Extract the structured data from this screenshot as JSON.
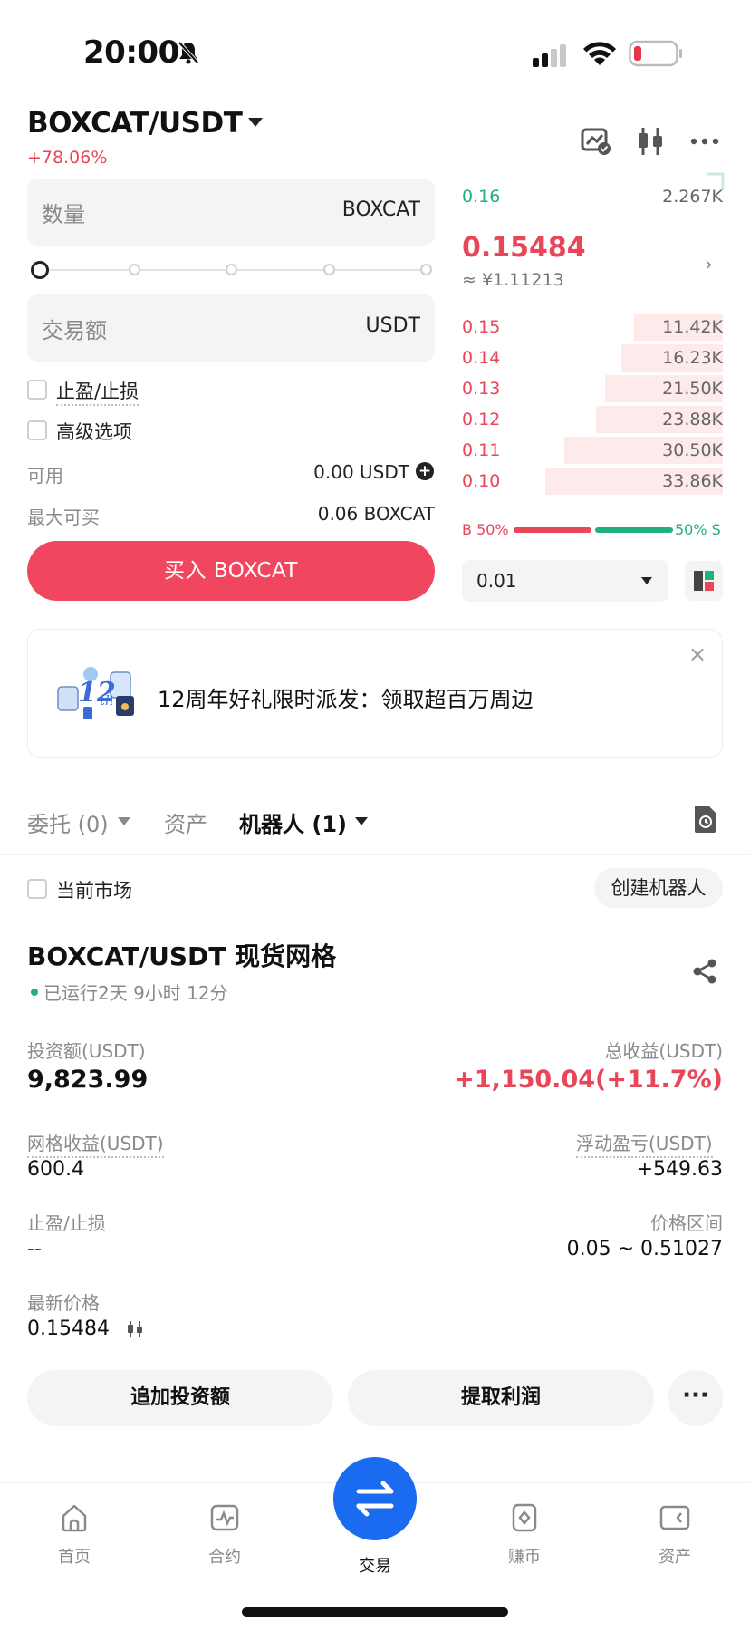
{
  "status_bar": {
    "time": "20:00"
  },
  "header": {
    "pair": "BOXCAT/USDT",
    "change": "+78.06%"
  },
  "order_form": {
    "quantity_placeholder": "数量",
    "quantity_unit": "BOXCAT",
    "amount_placeholder": "交易额",
    "amount_unit": "USDT",
    "tp_sl_label": "止盈/止损",
    "advanced_label": "高级选项",
    "available_label": "可用",
    "available_value": "0.00 USDT",
    "max_buy_label": "最大可买",
    "max_buy_value": "0.06 BOXCAT",
    "buy_button": "买入 BOXCAT",
    "slider_value_percent": 0
  },
  "orderbook": {
    "ask_top": {
      "price": "0.16",
      "qty": "2.267K"
    },
    "last_price": "0.15484",
    "cny_price": "≈ ¥1.11213",
    "bids": [
      {
        "price": "0.15",
        "qty": "11.42K",
        "depth": 0.28
      },
      {
        "price": "0.14",
        "qty": "16.23K",
        "depth": 0.32
      },
      {
        "price": "0.13",
        "qty": "21.50K",
        "depth": 0.37
      },
      {
        "price": "0.12",
        "qty": "23.88K",
        "depth": 0.4
      },
      {
        "price": "0.11",
        "qty": "30.50K",
        "depth": 0.5
      },
      {
        "price": "0.10",
        "qty": "33.86K",
        "depth": 0.56
      }
    ],
    "buy_ratio_label": "B 50%",
    "sell_ratio_label": "50% S",
    "buy_ratio": 0.5,
    "precision": "0.01"
  },
  "banner": {
    "text": "12周年好礼限时派发：领取超百万周边",
    "close": "×"
  },
  "tabs": {
    "orders": "委托 (0)",
    "assets": "资产",
    "bots": "机器人 (1)"
  },
  "filter": {
    "current_market": "当前市场",
    "create_bot": "创建机器人"
  },
  "bot": {
    "title": "BOXCAT/USDT 现货网格",
    "running": "已运行2天 9小时 12分",
    "investment_label": "投资额(USDT)",
    "investment_value": "9,823.99",
    "total_profit_label": "总收益(USDT)",
    "total_profit_value": "+1,150.04(+11.7%)",
    "grid_profit_label": "网格收益(USDT)",
    "grid_profit_value": "600.4",
    "floating_pnl_label": "浮动盈亏(USDT)",
    "floating_pnl_value": "+549.63",
    "tp_sl_label": "止盈/止损",
    "tp_sl_value": "--",
    "price_range_label": "价格区间",
    "price_range_value": "0.05 ~ 0.51027",
    "latest_price_label": "最新价格",
    "latest_price_value": "0.15484",
    "add_investment": "追加投资额",
    "withdraw_profit": "提取利润",
    "more": "···"
  },
  "bottom_nav": {
    "home": "首页",
    "futures": "合约",
    "trade": "交易",
    "earn": "赚币",
    "assets": "资产"
  },
  "colors": {
    "red": "#e8475a",
    "green": "#22b07d",
    "blue": "#1a6bf0"
  }
}
